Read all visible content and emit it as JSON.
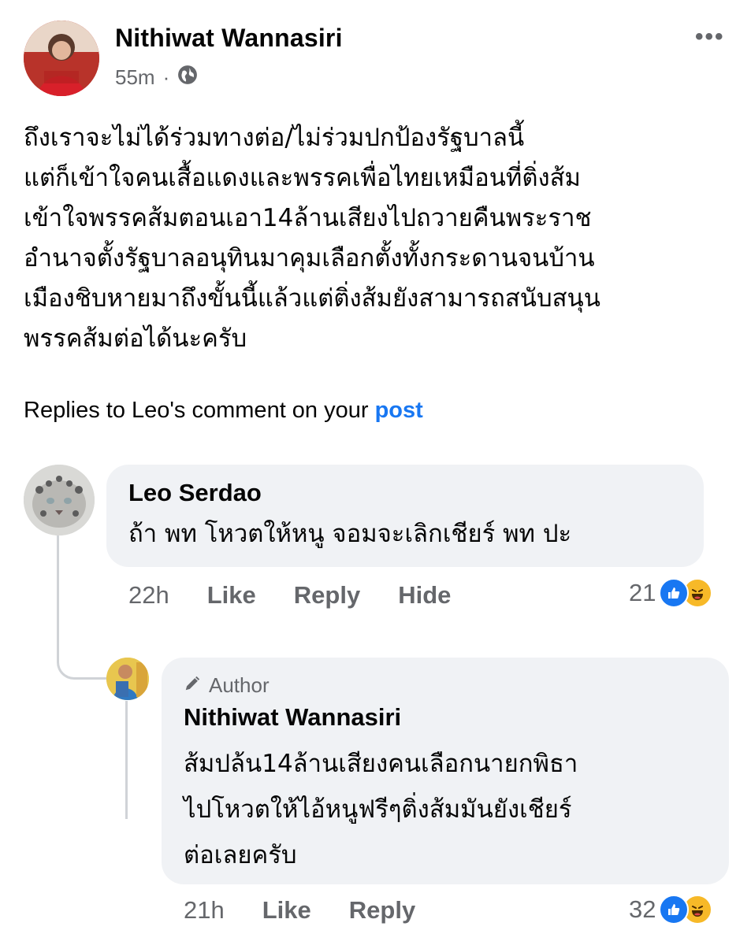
{
  "post": {
    "author": "Nithiwat Wannasiri",
    "time": "55m",
    "separator": "·",
    "body": "ถึงเราจะไม่ได้ร่วมทางต่อ/ไม่ร่วมปกป้องรัฐบาลนี้\nแต่ก็เข้าใจคนเสื้อแดงและพรรคเพื่อไทยเหมือนที่ติ่งส้ม\nเข้าใจพรรคส้มตอนเอา14ล้านเสียงไปถวายคืนพระราช\nอำนาจตั้งรัฐบาลอนุทินมาคุมเลือกตั้งทั้งกระดานจนบ้าน\nเมืองชิบหายมาถึงขั้นนี้แล้วแต่ติ่งส้มยังสามารถสนับสนุน\nพรรคส้มต่อได้นะครับ",
    "avatar_caption": ""
  },
  "replies_header": {
    "text": "Replies to Leo's comment on your ",
    "link": "post"
  },
  "comments": [
    {
      "name": "Leo Serdao",
      "text": "ถ้า พท โหวตให้หนู จอมจะเลิกเชียร์ พท ปะ",
      "time": "22h",
      "actions": [
        "Like",
        "Reply",
        "Hide"
      ],
      "reaction_count": "21"
    },
    {
      "badge": "Author",
      "name": "Nithiwat Wannasiri",
      "text": "ส้มปล้น14ล้านเสียงคนเลือกนายกพิธา\nไปโหวตให้ไอ้หนูฟรีๆติ่งส้มมันยังเชียร์\nต่อเลยครับ",
      "time": "21h",
      "actions": [
        "Like",
        "Reply"
      ],
      "reaction_count": "32"
    }
  ],
  "colors": {
    "link": "#1877f2",
    "muted": "#65676b",
    "bubble": "#f0f2f5",
    "like": "#1877f2",
    "haha": "#f7b928"
  },
  "icons": {
    "more": "more-horizontal-icon",
    "audience": "globe-icon",
    "author_badge": "pencil-icon",
    "reactions": [
      "like-reaction-icon",
      "haha-reaction-icon"
    ]
  }
}
